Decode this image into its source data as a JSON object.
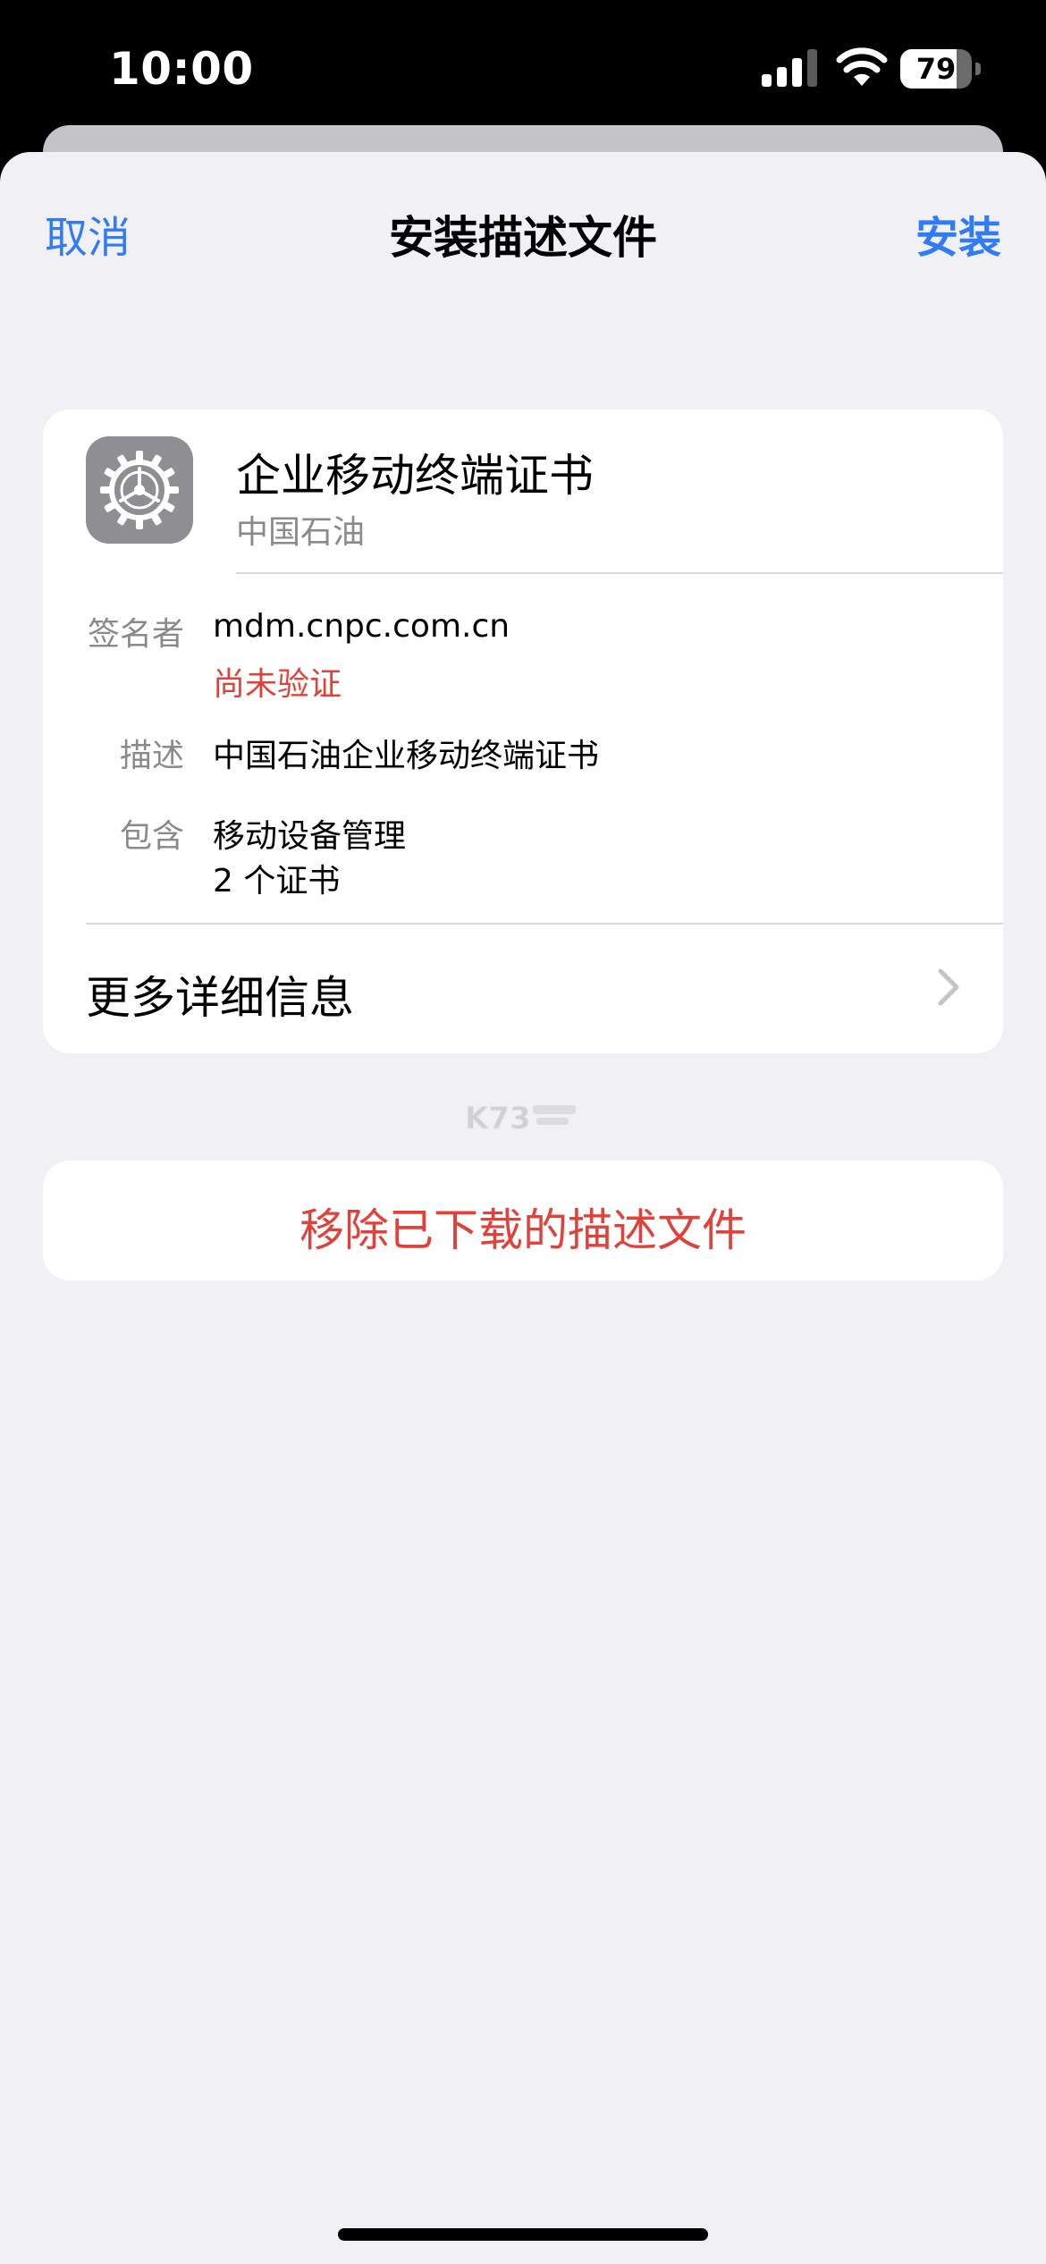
{
  "status_bar": {
    "time": "10:00",
    "battery_level": "79",
    "battery_fraction": 0.79
  },
  "nav": {
    "cancel_label": "取消",
    "title": "安装描述文件",
    "install_label": "安装"
  },
  "profile": {
    "name": "企业移动终端证书",
    "organization": "中国石油",
    "icon": "gear-icon",
    "rows": {
      "signer_label": "签名者",
      "signer_value": "mdm.cnpc.com.cn",
      "signer_status": "尚未验证",
      "description_label": "描述",
      "description_value": "中国石油企业移动终端证书",
      "contains_label": "包含",
      "contains_value_1": "移动设备管理",
      "contains_value_2": "2 个证书"
    },
    "more_details_label": "更多详细信息"
  },
  "watermark_text": "K73",
  "remove_label": "移除已下载的描述文件",
  "colors": {
    "accent": "#2f7cf6",
    "destructive": "#e0423a",
    "background": "#f0f0f5",
    "secondary_text": "#8a8a8e"
  }
}
